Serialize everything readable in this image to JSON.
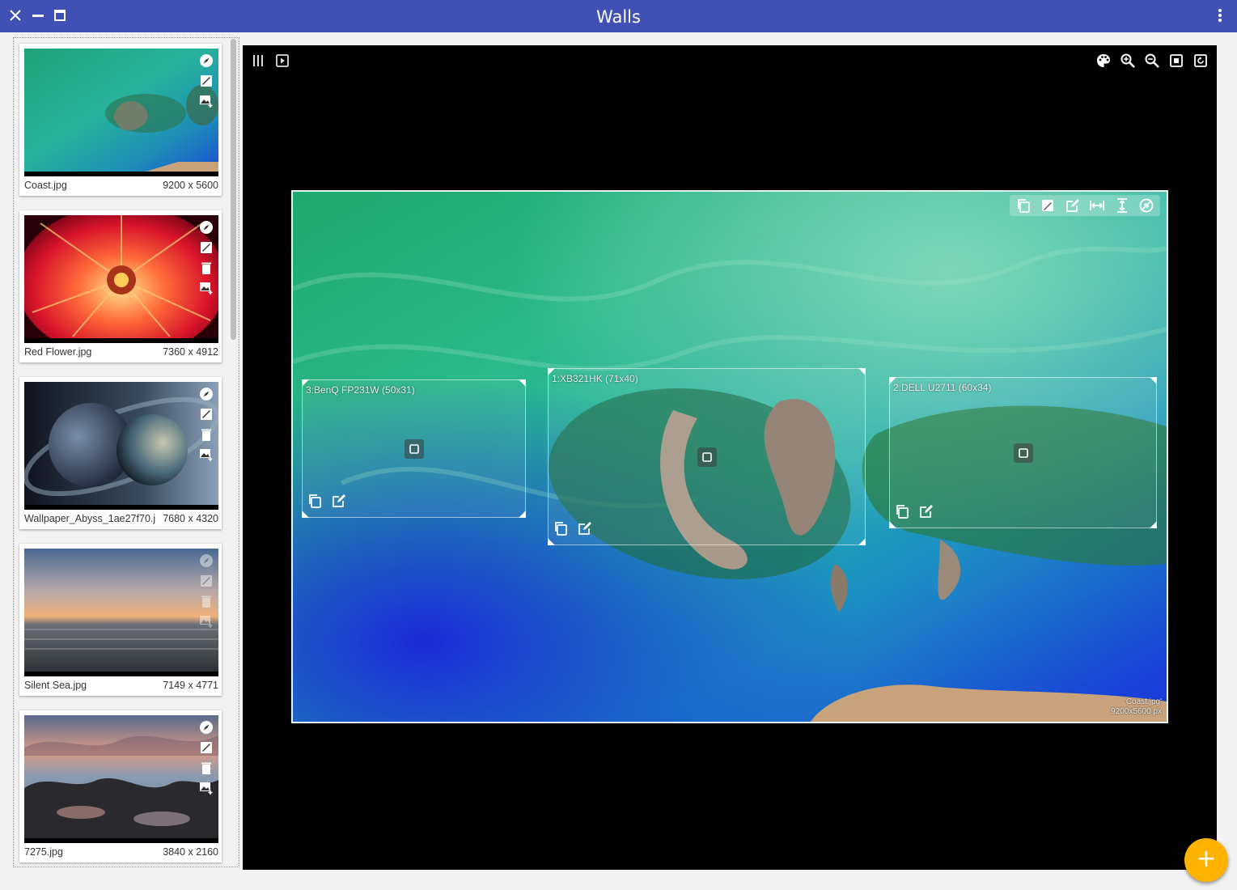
{
  "window": {
    "title": "Walls",
    "close_icon": "close-icon",
    "minimize_icon": "minimize-icon",
    "maximize_icon": "maximize-icon",
    "menu_icon": "more-vert-icon",
    "title_bar_color": "#3f51b5"
  },
  "sidebar": {
    "items": [
      {
        "name": "Coast.jpg",
        "size": "9200 x 5600",
        "icons": [
          "compass-icon",
          "image-edit-icon",
          "add-to-screens-icon"
        ]
      },
      {
        "name": "Red Flower.jpg",
        "size": "7360 x 4912",
        "icons": [
          "compass-icon",
          "image-edit-icon",
          "delete-icon",
          "add-to-screens-icon"
        ]
      },
      {
        "name": "Wallpaper_Abyss_1ae27f70.j",
        "size": "7680 x 4320",
        "icons": [
          "compass-icon",
          "image-edit-icon",
          "delete-icon",
          "add-to-screens-icon"
        ]
      },
      {
        "name": "Silent Sea.jpg",
        "size": "7149 x 4771",
        "icons": [
          "compass-icon",
          "image-edit-icon",
          "delete-icon",
          "add-to-screens-icon"
        ]
      },
      {
        "name": "7275.jpg",
        "size": "3840 x 2160",
        "icons": [
          "compass-icon",
          "image-edit-icon",
          "delete-icon",
          "add-to-screens-icon"
        ]
      }
    ]
  },
  "viewer": {
    "left_icons": [
      "columns-icon",
      "slideshow-icon"
    ],
    "right_icons": [
      "palette-icon",
      "zoom-in-icon",
      "zoom-out-icon",
      "fit-screen-icon",
      "rotate-icon"
    ],
    "wallpaper_tools": [
      "copy-icon",
      "image-edit-icon",
      "edit-icon",
      "fit-width-icon",
      "fit-height-icon",
      "no-crop-icon"
    ],
    "caption_name": "'Coast.jpg'",
    "caption_size": "9200x5600 px",
    "monitors": [
      {
        "label": "3:BenQ FP231W (50x31)"
      },
      {
        "label": "1:XB321HK (71x40)"
      },
      {
        "label": "2:DELL U2711 (60x34)"
      }
    ]
  },
  "fab": {
    "label": "+",
    "color": "#ffb300"
  }
}
